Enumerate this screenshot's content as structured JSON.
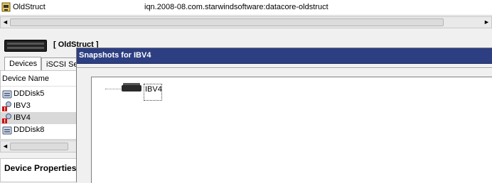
{
  "target": {
    "name": "OldStruct",
    "iqn": "iqn.2008-08.com.starwindsoftware:datacore-oldstruct"
  },
  "server": {
    "title": "[ OldStruct ]"
  },
  "tabs": [
    {
      "label": "Devices"
    },
    {
      "label": "iSCSI Sessions"
    }
  ],
  "device_list": {
    "column_header": "Device Name",
    "items": [
      {
        "label": "DDDisk5",
        "icon": "disk-icon"
      },
      {
        "label": "IBV3",
        "icon": "warning-disk-icon"
      },
      {
        "label": "IBV4",
        "icon": "warning-disk-icon",
        "selected": true
      },
      {
        "label": "DDDisk8",
        "icon": "disk-icon"
      }
    ]
  },
  "properties": {
    "title": "Device Properties"
  },
  "dialog": {
    "title": "Snapshots for IBV4",
    "node_label": "IBV4"
  },
  "scroll": {
    "left_arrow": "◄",
    "right_arrow": "►"
  }
}
